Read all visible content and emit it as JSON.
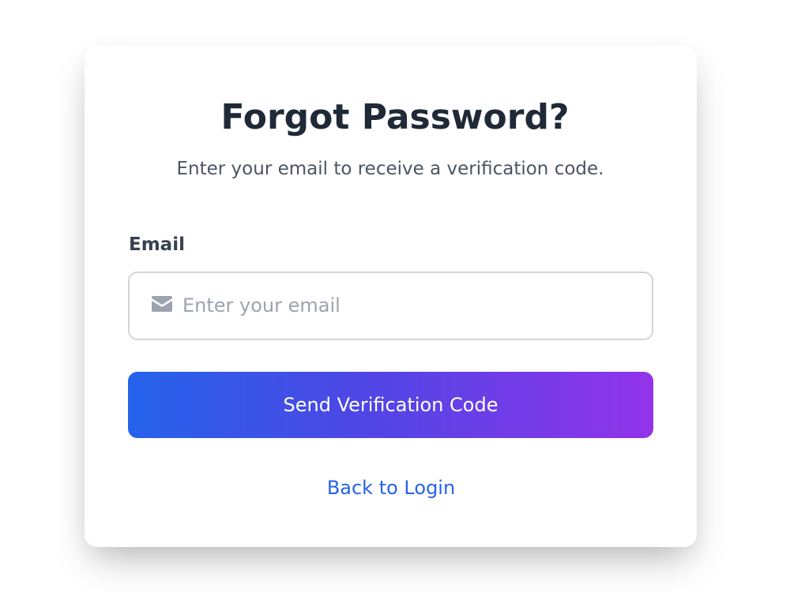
{
  "form": {
    "title": "Forgot Password?",
    "subtitle": "Enter your email to receive a verification code.",
    "email_label": "Email",
    "email_placeholder": "Enter your email",
    "email_value": "",
    "email_icon": "envelope-icon",
    "submit_label": "Send Verification Code",
    "back_link_label": "Back to Login"
  },
  "colors": {
    "title": "#1f2937",
    "subtitle": "#4b5563",
    "label": "#374151",
    "placeholder": "#9ca3af",
    "input_border": "#d1d5db",
    "icon": "#9ca3af",
    "button_gradient_start": "#2563eb",
    "button_gradient_mid": "#4f46e5",
    "button_gradient_end": "#9333ea",
    "button_text": "#ffffff",
    "link": "#2563eb",
    "card_background": "#ffffff"
  }
}
